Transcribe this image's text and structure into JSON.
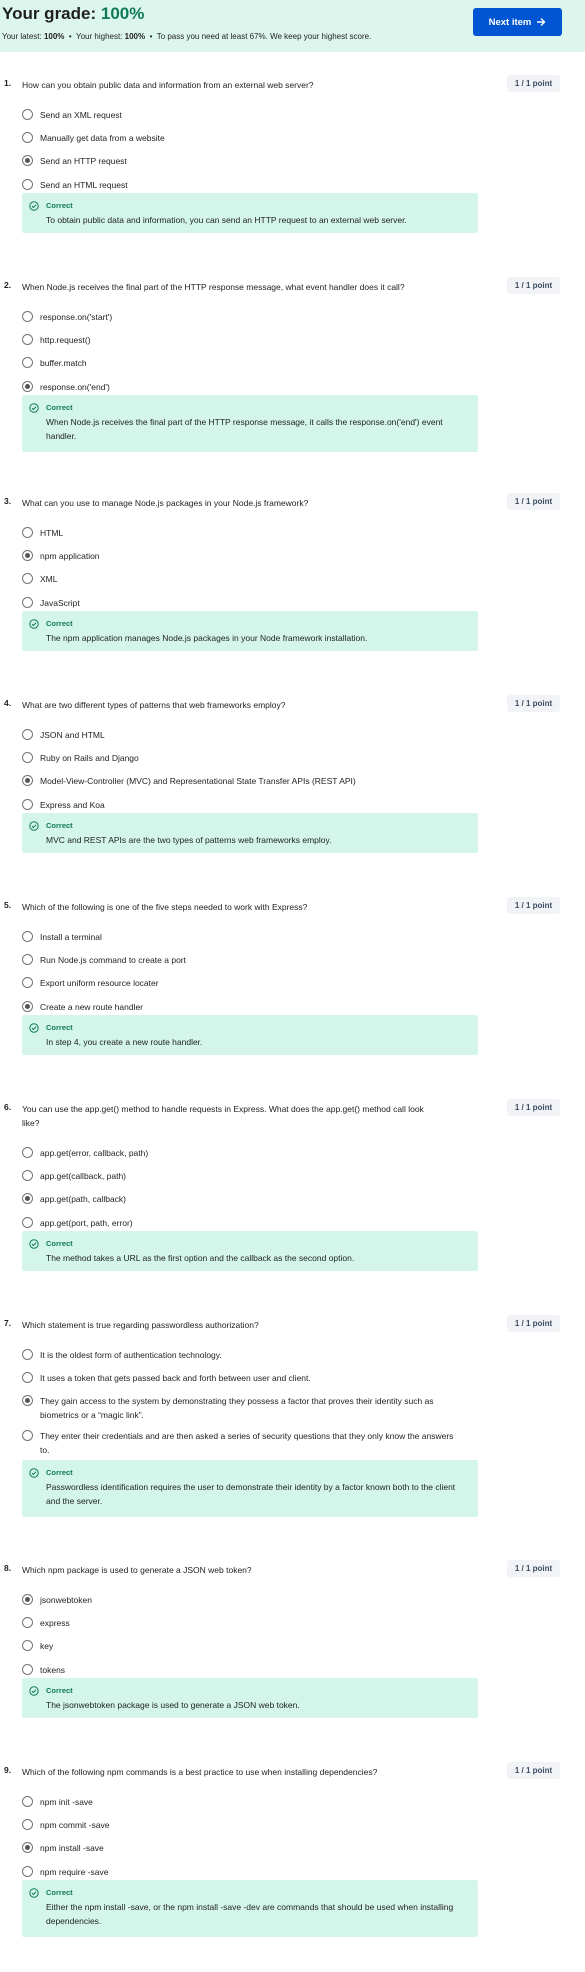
{
  "header": {
    "title_prefix": "Your grade: ",
    "grade": "100%",
    "latest_label": "Your latest: ",
    "latest_value": "100%",
    "highest_label": "Your highest: ",
    "highest_value": "100%",
    "pass_note": "To pass you need at least 67%. We keep your highest score.",
    "separator": "•",
    "next_button": "Next item"
  },
  "feedback_label": "Correct",
  "colors": {
    "banner": "#dcf6ee",
    "accent": "#0056d2",
    "correct": "#0f7a55",
    "feedback_bg": "#d4f6ea"
  },
  "questions": [
    {
      "num": "1.",
      "text": "How can you obtain public data and information from an external web server?",
      "points": "1 / 1 point",
      "options": [
        "Send an XML request",
        "Manually get data from a website",
        "Send an HTTP request",
        "Send an HTML request"
      ],
      "selected": 2,
      "feedback": "To obtain public data and information, you can send an HTTP request to an external web server."
    },
    {
      "num": "2.",
      "text": "When Node.js receives the final part of the HTTP response message, what event handler does it call?",
      "points": "1 / 1 point",
      "options": [
        "response.on('start')",
        "http.request()",
        "buffer.match",
        "response.on('end')"
      ],
      "selected": 3,
      "feedback": "When Node.js receives the final part of the HTTP response message, it calls the response.on('end') event handler."
    },
    {
      "num": "3.",
      "text": "What can you use to manage Node.js packages in your Node.js framework?",
      "points": "1 / 1 point",
      "options": [
        "HTML",
        "npm application",
        "XML",
        "JavaScript"
      ],
      "selected": 1,
      "feedback": "The npm application manages Node.js packages in your Node framework installation."
    },
    {
      "num": "4.",
      "text": "What are two different types of patterns that web frameworks employ?",
      "points": "1 / 1 point",
      "options": [
        "JSON and HTML",
        "Ruby on Rails and Django",
        "Model-View-Controller (MVC) and Representational State Transfer APIs (REST API)",
        "Express and Koa"
      ],
      "selected": 2,
      "feedback": "MVC and REST APIs are the two types of patterns web frameworks employ."
    },
    {
      "num": "5.",
      "text": "Which of the following is one of the five steps needed to work with Express?",
      "points": "1 / 1 point",
      "options": [
        "Install a terminal",
        "Run Node.js command to create a port",
        "Export uniform resource locater",
        "Create a new route handler"
      ],
      "selected": 3,
      "feedback": "In step 4, you create a new route handler."
    },
    {
      "num": "6.",
      "text": "You can use the app.get() method to handle requests in Express. What does the app.get() method call look like?",
      "points": "1 / 1 point",
      "options": [
        "app.get(error, callback, path)",
        "app.get(callback, path)",
        "app.get(path, callback)",
        "app.get(port, path, error)"
      ],
      "selected": 2,
      "feedback": "The method takes a URL as the first option and the callback as the second option."
    },
    {
      "num": "7.",
      "text": "Which statement is true regarding passwordless authorization?",
      "points": "1 / 1 point",
      "options": [
        "It is the oldest form of authentication technology.",
        "It uses a token that gets passed back and forth between user and client.",
        "They gain access to the system by demonstrating they possess a factor that proves their identity such as biometrics or a “magic link”.",
        "They enter their credentials and are then asked a series of security questions that they only know the answers to."
      ],
      "selected": 2,
      "feedback": "Passwordless identification requires the user to demonstrate their identity by a factor known both to the client and the server."
    },
    {
      "num": "8.",
      "text": "Which npm package is used to generate a JSON web token?",
      "points": "1 / 1 point",
      "options": [
        "jsonwebtoken",
        "express",
        "key",
        "tokens"
      ],
      "selected": 0,
      "feedback": "The jsonwebtoken package is used to generate a JSON web token."
    },
    {
      "num": "9.",
      "text": "Which of the following npm commands is a best practice to use when installing dependencies?",
      "points": "1 / 1 point",
      "options": [
        "npm init -save",
        "npm commit -save",
        "npm install -save",
        "npm require -save"
      ],
      "selected": 2,
      "feedback": "Either the npm install -save, or the npm install -save -dev are commands that should be used when installing dependencies."
    }
  ]
}
